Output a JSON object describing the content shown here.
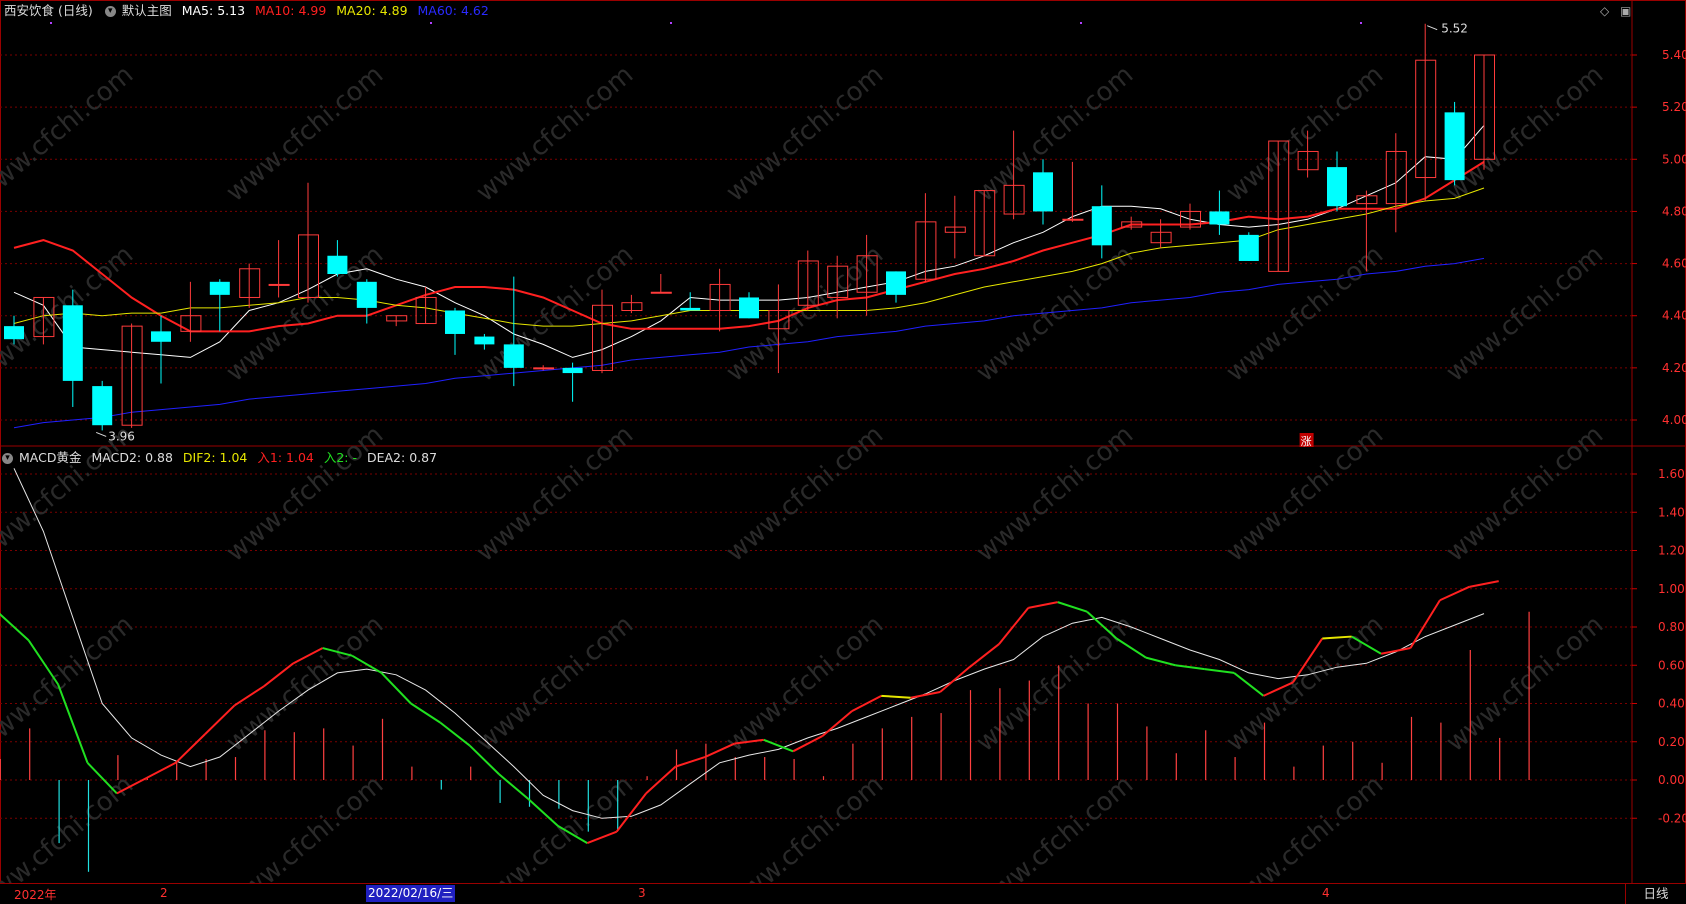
{
  "main_header": {
    "stock": "西安饮食 (日线)",
    "template": "默认主图",
    "ma5": "MA5: 5.13",
    "ma10": "MA10: 4.99",
    "ma20": "MA20: 4.89",
    "ma60": "MA60: 4.62"
  },
  "macd_header": {
    "name": "MACD黄金",
    "macd2": "MACD2: 0.88",
    "dif2": "DIF2: 1.04",
    "buy1": "入1: 1.04",
    "buy2": "入2: -",
    "dea2": "DEA2: 0.87"
  },
  "x_axis": {
    "labels": [
      "2022年",
      "2",
      "3",
      "4"
    ],
    "cursor_date": "2022/02/16/三",
    "period_button": "日线"
  },
  "annotations": {
    "high": "5.52",
    "low": "3.96",
    "signal": "涨"
  },
  "watermark": "www.cfchi.com",
  "colors": {
    "background": "#000000",
    "up": "#ff3b3b",
    "down": "#00ffff",
    "ma5": "#ffffff",
    "ma10": "#ff2020",
    "ma20": "#e6e600",
    "ma60": "#2020ff",
    "grid": "#7a0000"
  },
  "chart_data": [
    {
      "type": "candlestick",
      "y_ticks": [
        "5.40",
        "5.20",
        "5.00",
        "4.80",
        "4.60",
        "4.40",
        "4.20",
        "4.00"
      ],
      "ylim": [
        3.96,
        5.52
      ],
      "candles": [
        {
          "o": 4.36,
          "h": 4.4,
          "l": 4.29,
          "c": 4.31
        },
        {
          "o": 4.32,
          "h": 4.47,
          "l": 4.29,
          "c": 4.47
        },
        {
          "o": 4.44,
          "h": 4.5,
          "l": 4.05,
          "c": 4.15
        },
        {
          "o": 4.13,
          "h": 4.15,
          "l": 3.96,
          "c": 3.98
        },
        {
          "o": 3.98,
          "h": 4.37,
          "l": 3.97,
          "c": 4.36
        },
        {
          "o": 4.34,
          "h": 4.4,
          "l": 4.14,
          "c": 4.3
        },
        {
          "o": 4.34,
          "h": 4.53,
          "l": 4.3,
          "c": 4.4
        },
        {
          "o": 4.53,
          "h": 4.54,
          "l": 4.34,
          "c": 4.48
        },
        {
          "o": 4.47,
          "h": 4.6,
          "l": 4.43,
          "c": 4.58
        },
        {
          "o": 4.52,
          "h": 4.69,
          "l": 4.47,
          "c": 4.52
        },
        {
          "o": 4.47,
          "h": 4.91,
          "l": 4.45,
          "c": 4.71
        },
        {
          "o": 4.63,
          "h": 4.69,
          "l": 4.55,
          "c": 4.56
        },
        {
          "o": 4.53,
          "h": 4.54,
          "l": 4.37,
          "c": 4.43
        },
        {
          "o": 4.38,
          "h": 4.4,
          "l": 4.36,
          "c": 4.4
        },
        {
          "o": 4.37,
          "h": 4.51,
          "l": 4.37,
          "c": 4.47
        },
        {
          "o": 4.42,
          "h": 4.43,
          "l": 4.25,
          "c": 4.33
        },
        {
          "o": 4.32,
          "h": 4.33,
          "l": 4.27,
          "c": 4.29
        },
        {
          "o": 4.29,
          "h": 4.55,
          "l": 4.13,
          "c": 4.2
        },
        {
          "o": 4.2,
          "h": 4.21,
          "l": 4.19,
          "c": 4.2
        },
        {
          "o": 4.2,
          "h": 4.22,
          "l": 4.07,
          "c": 4.18
        },
        {
          "o": 4.19,
          "h": 4.5,
          "l": 4.18,
          "c": 4.44
        },
        {
          "o": 4.42,
          "h": 4.48,
          "l": 4.41,
          "c": 4.45
        },
        {
          "o": 4.49,
          "h": 4.56,
          "l": 4.49,
          "c": 4.49
        },
        {
          "o": 4.43,
          "h": 4.49,
          "l": 4.42,
          "c": 4.42
        },
        {
          "o": 4.42,
          "h": 4.58,
          "l": 4.34,
          "c": 4.52
        },
        {
          "o": 4.47,
          "h": 4.49,
          "l": 4.39,
          "c": 4.39
        },
        {
          "o": 4.35,
          "h": 4.52,
          "l": 4.18,
          "c": 4.42
        },
        {
          "o": 4.44,
          "h": 4.65,
          "l": 4.42,
          "c": 4.61
        },
        {
          "o": 4.47,
          "h": 4.63,
          "l": 4.39,
          "c": 4.59
        },
        {
          "o": 4.49,
          "h": 4.71,
          "l": 4.4,
          "c": 4.63
        },
        {
          "o": 4.57,
          "h": 4.57,
          "l": 4.45,
          "c": 4.48
        },
        {
          "o": 4.54,
          "h": 4.87,
          "l": 4.53,
          "c": 4.76
        },
        {
          "o": 4.72,
          "h": 4.86,
          "l": 4.62,
          "c": 4.74
        },
        {
          "o": 4.63,
          "h": 4.88,
          "l": 4.63,
          "c": 4.88
        },
        {
          "o": 4.79,
          "h": 5.11,
          "l": 4.77,
          "c": 4.9
        },
        {
          "o": 4.95,
          "h": 5.0,
          "l": 4.75,
          "c": 4.8
        },
        {
          "o": 4.77,
          "h": 4.99,
          "l": 4.76,
          "c": 4.77
        },
        {
          "o": 4.82,
          "h": 4.9,
          "l": 4.62,
          "c": 4.67
        },
        {
          "o": 4.74,
          "h": 4.78,
          "l": 4.73,
          "c": 4.76
        },
        {
          "o": 4.68,
          "h": 4.77,
          "l": 4.66,
          "c": 4.72
        },
        {
          "o": 4.74,
          "h": 4.83,
          "l": 4.73,
          "c": 4.8
        },
        {
          "o": 4.8,
          "h": 4.88,
          "l": 4.71,
          "c": 4.75
        },
        {
          "o": 4.71,
          "h": 4.72,
          "l": 4.61,
          "c": 4.61
        },
        {
          "o": 4.57,
          "h": 5.07,
          "l": 4.57,
          "c": 5.07
        },
        {
          "o": 4.96,
          "h": 5.11,
          "l": 4.93,
          "c": 5.03
        },
        {
          "o": 4.97,
          "h": 5.03,
          "l": 4.8,
          "c": 4.82
        },
        {
          "o": 4.83,
          "h": 4.88,
          "l": 4.57,
          "c": 4.86
        },
        {
          "o": 4.83,
          "h": 5.1,
          "l": 4.72,
          "c": 5.03
        },
        {
          "o": 4.93,
          "h": 5.52,
          "l": 4.84,
          "c": 5.38
        },
        {
          "o": 5.18,
          "h": 5.22,
          "l": 4.9,
          "c": 4.92
        },
        {
          "o": 5.0,
          "h": 5.4,
          "l": 4.96,
          "c": 5.4
        }
      ],
      "series": [
        {
          "name": "MA5",
          "values": [
            4.49,
            4.44,
            4.28,
            4.27,
            4.26,
            4.25,
            4.24,
            4.3,
            4.42,
            4.45,
            4.5,
            4.56,
            4.58,
            4.54,
            4.51,
            4.45,
            4.4,
            4.33,
            4.29,
            4.24,
            4.27,
            4.32,
            4.38,
            4.47,
            4.46,
            4.46,
            4.46,
            4.47,
            4.49,
            4.51,
            4.53,
            4.57,
            4.59,
            4.63,
            4.68,
            4.72,
            4.78,
            4.82,
            4.82,
            4.81,
            4.77,
            4.75,
            4.74,
            4.75,
            4.77,
            4.81,
            4.86,
            4.91,
            5.01,
            5.0,
            5.13
          ]
        },
        {
          "name": "MA10",
          "values": [
            4.66,
            4.69,
            4.65,
            4.56,
            4.47,
            4.4,
            4.34,
            4.34,
            4.34,
            4.36,
            4.37,
            4.4,
            4.4,
            4.44,
            4.48,
            4.51,
            4.51,
            4.5,
            4.47,
            4.42,
            4.37,
            4.35,
            4.35,
            4.35,
            4.35,
            4.36,
            4.38,
            4.43,
            4.46,
            4.47,
            4.5,
            4.53,
            4.56,
            4.58,
            4.61,
            4.65,
            4.68,
            4.71,
            4.75,
            4.75,
            4.75,
            4.76,
            4.78,
            4.77,
            4.78,
            4.81,
            4.81,
            4.81,
            4.85,
            4.92,
            4.99
          ]
        },
        {
          "name": "MA20",
          "values": [
            4.37,
            4.4,
            4.41,
            4.4,
            4.41,
            4.41,
            4.43,
            4.43,
            4.44,
            4.45,
            4.47,
            4.47,
            4.46,
            4.44,
            4.43,
            4.41,
            4.39,
            4.37,
            4.36,
            4.36,
            4.37,
            4.38,
            4.4,
            4.42,
            4.42,
            4.42,
            4.42,
            4.42,
            4.42,
            4.42,
            4.43,
            4.45,
            4.48,
            4.51,
            4.53,
            4.55,
            4.57,
            4.6,
            4.64,
            4.66,
            4.67,
            4.68,
            4.69,
            4.73,
            4.75,
            4.77,
            4.79,
            4.82,
            4.84,
            4.85,
            4.89
          ]
        },
        {
          "name": "MA60",
          "values": [
            3.97,
            3.99,
            4.0,
            4.01,
            4.03,
            4.04,
            4.05,
            4.06,
            4.08,
            4.09,
            4.1,
            4.11,
            4.12,
            4.13,
            4.14,
            4.16,
            4.17,
            4.18,
            4.19,
            4.2,
            4.21,
            4.23,
            4.24,
            4.25,
            4.26,
            4.28,
            4.29,
            4.3,
            4.32,
            4.33,
            4.34,
            4.36,
            4.37,
            4.38,
            4.4,
            4.41,
            4.42,
            4.43,
            4.45,
            4.46,
            4.47,
            4.49,
            4.5,
            4.52,
            4.53,
            4.54,
            4.56,
            4.57,
            4.59,
            4.6,
            4.62
          ]
        }
      ]
    },
    {
      "type": "line",
      "y_ticks": [
        "1.60",
        "1.40",
        "1.20",
        "1.00",
        "0.80",
        "0.60",
        "0.40",
        "0.20",
        "0.00",
        "-0.20"
      ],
      "ylim": [
        -0.35,
        1.7
      ],
      "series": [
        {
          "name": "DIF2",
          "values": [
            0.87,
            0.73,
            0.5,
            0.09,
            -0.07,
            0.01,
            0.09,
            0.24,
            0.39,
            0.49,
            0.61,
            0.69,
            0.65,
            0.56,
            0.4,
            0.3,
            0.18,
            0.03,
            -0.1,
            -0.24,
            -0.33,
            -0.27,
            -0.07,
            0.07,
            0.12,
            0.19,
            0.21,
            0.15,
            0.23,
            0.36,
            0.44,
            0.43,
            0.46,
            0.59,
            0.71,
            0.9,
            0.93,
            0.88,
            0.74,
            0.64,
            0.6,
            0.58,
            0.56,
            0.44,
            0.51,
            0.74,
            0.75,
            0.66,
            0.69,
            0.94,
            1.01,
            1.04
          ]
        },
        {
          "name": "DEA2",
          "values": [
            1.63,
            1.3,
            0.85,
            0.4,
            0.22,
            0.13,
            0.07,
            0.12,
            0.24,
            0.36,
            0.47,
            0.56,
            0.58,
            0.55,
            0.47,
            0.35,
            0.21,
            0.07,
            -0.08,
            -0.16,
            -0.2,
            -0.19,
            -0.13,
            -0.02,
            0.09,
            0.13,
            0.16,
            0.22,
            0.27,
            0.33,
            0.39,
            0.45,
            0.52,
            0.58,
            0.63,
            0.75,
            0.82,
            0.85,
            0.8,
            0.74,
            0.68,
            0.63,
            0.56,
            0.53,
            0.55,
            0.59,
            0.61,
            0.67,
            0.75,
            0.81,
            0.87
          ]
        },
        {
          "name": "MACD2",
          "values": [
            0.11,
            0.27,
            -0.33,
            -0.48,
            0.13,
            0.01,
            0.09,
            0.11,
            0.12,
            0.26,
            0.25,
            0.27,
            0.18,
            0.32,
            0.07,
            -0.05,
            0.07,
            -0.12,
            -0.14,
            -0.15,
            -0.27,
            -0.26,
            0.02,
            0.16,
            0.19,
            0.12,
            0.12,
            0.11,
            0.02,
            0.19,
            0.27,
            0.33,
            0.35,
            0.47,
            0.48,
            0.52,
            0.6,
            0.4,
            0.4,
            0.28,
            0.14,
            0.26,
            0.12,
            0.3,
            0.07,
            0.18,
            0.2,
            0.09,
            0.33,
            0.3,
            0.68,
            0.22,
            0.88
          ]
        }
      ]
    }
  ]
}
